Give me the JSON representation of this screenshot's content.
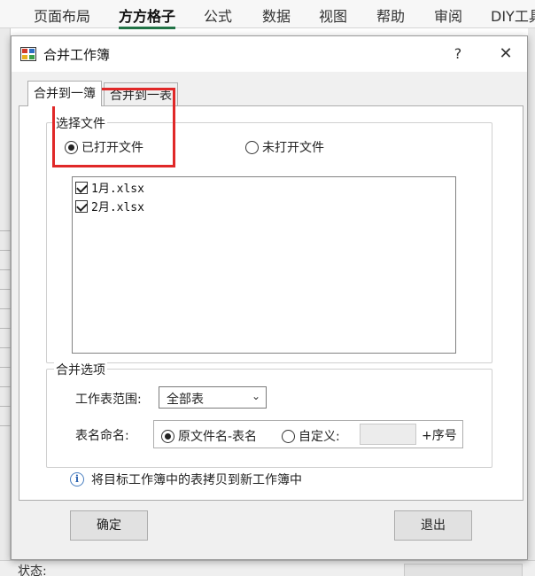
{
  "ribbon": {
    "tabs": [
      "页面布局",
      "方方格子",
      "公式",
      "数据",
      "视图",
      "帮助",
      "审阅",
      "DIY工具箱"
    ],
    "active_tab": "方方格子"
  },
  "dialog": {
    "title": "合并工作簿",
    "help_glyph": "?",
    "close_glyph": "✕",
    "tabs": [
      {
        "label": "合并到一簿",
        "active": true
      },
      {
        "label": "合并到一表",
        "active": false
      }
    ],
    "select_files": {
      "legend": "选择文件",
      "radio_open": "已打开文件",
      "radio_unopened": "未打开文件",
      "selected": "open",
      "files": [
        {
          "name": "1月.xlsx",
          "checked": true
        },
        {
          "name": "2月.xlsx",
          "checked": true
        }
      ]
    },
    "merge_options": {
      "legend": "合并选项",
      "range_label": "工作表范围:",
      "range_value": "全部表",
      "naming_label": "表名命名:",
      "naming_original": "原文件名-表名",
      "naming_custom": "自定义:",
      "naming_selected": "original",
      "seq_label": "+序号"
    },
    "info_text": "将目标工作簿中的表拷贝到新工作簿中",
    "ok_label": "确定",
    "exit_label": "退出"
  },
  "status": {
    "label": "状态:"
  },
  "colors": {
    "highlight": "#e02828",
    "accent": "#217346"
  }
}
